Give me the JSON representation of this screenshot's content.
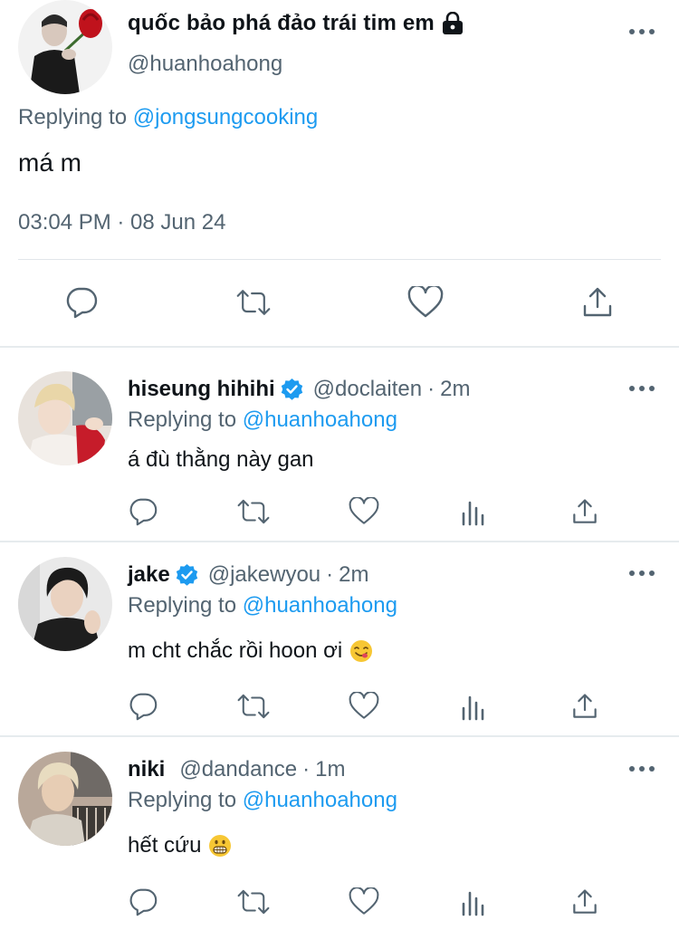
{
  "main_tweet": {
    "display_name": "quốc bảo phá đảo trái tim em",
    "handle": "@huanhoahong",
    "replying_label": "Replying to",
    "replying_to": "@jongsungcooking",
    "text": "má m",
    "timestamp": "03:04 PM · 08 Jun 24",
    "actions": [
      "reply-icon",
      "retweet-icon",
      "like-icon",
      "share-icon"
    ]
  },
  "replies": [
    {
      "display_name": "hiseung hihihi",
      "verified": true,
      "handle": "@doclaiten",
      "dot": "·",
      "time": "2m",
      "replying_label": "Replying to",
      "replying_to": "@huanhoahong",
      "text": "á đù thằng này gan",
      "emoji": null
    },
    {
      "display_name": "jake",
      "verified": true,
      "handle": "@jakewyou",
      "dot": "·",
      "time": "2m",
      "replying_label": "Replying to",
      "replying_to": "@huanhoahong",
      "text": "m cht chắc rồi hoon ơi",
      "emoji": "yum-emoji"
    },
    {
      "display_name": "niki",
      "verified": false,
      "handle": "@dandance",
      "dot": "·",
      "time": "1m",
      "replying_label": "Replying to",
      "replying_to": "@huanhoahong",
      "text": "hết cứu",
      "emoji": "grimace-emoji"
    }
  ],
  "reply_actions": [
    "reply-icon",
    "retweet-icon",
    "like-icon",
    "views-icon",
    "share-icon"
  ],
  "colors": {
    "link": "#1d9bf0",
    "secondary_text": "#536471",
    "primary_text": "#0f1419",
    "verified": "#1d9bf0",
    "divider": "#e6ebee"
  }
}
